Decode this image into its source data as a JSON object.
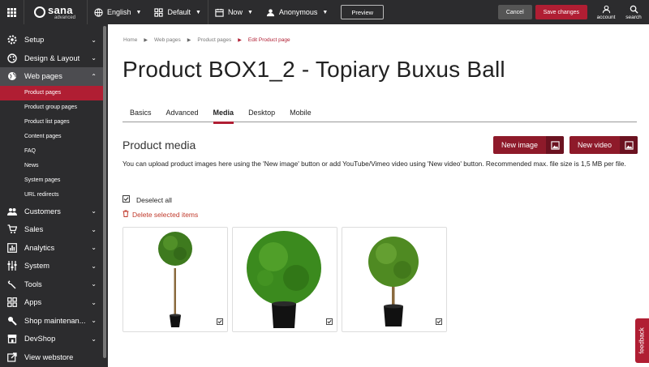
{
  "topbar": {
    "logo_name": "sana",
    "logo_sub": "advanced",
    "language": "English",
    "layout": "Default",
    "date": "Now",
    "user": "Anonymous",
    "preview_label": "Preview",
    "cancel_label": "Cancel",
    "save_label": "Save changes",
    "account_label": "account",
    "search_label": "search"
  },
  "sidebar": {
    "items": [
      {
        "label": "Setup",
        "icon": "gear-icon"
      },
      {
        "label": "Design & Layout",
        "icon": "palette-icon"
      },
      {
        "label": "Web pages",
        "icon": "globe-icon",
        "active": true
      },
      {
        "label": "Customers",
        "icon": "people-icon"
      },
      {
        "label": "Sales",
        "icon": "cart-icon"
      },
      {
        "label": "Analytics",
        "icon": "chart-icon"
      },
      {
        "label": "System",
        "icon": "sliders-icon"
      },
      {
        "label": "Tools",
        "icon": "wrench-icon"
      },
      {
        "label": "Apps",
        "icon": "apps-icon"
      },
      {
        "label": "Shop maintenan...",
        "icon": "maintenance-icon"
      },
      {
        "label": "DevShop",
        "icon": "shop-icon"
      },
      {
        "label": "View webstore",
        "icon": "external-link-icon"
      }
    ],
    "subitems": [
      "Product pages",
      "Product group pages",
      "Product list pages",
      "Content pages",
      "FAQ",
      "News",
      "System pages",
      "URL redirects"
    ]
  },
  "breadcrumb": [
    "Home",
    "Web pages",
    "Product pages",
    "Edit Product page"
  ],
  "page_title": "Product BOX1_2 - Topiary Buxus Ball",
  "tabs": [
    "Basics",
    "Advanced",
    "Media",
    "Desktop",
    "Mobile"
  ],
  "media": {
    "section_title": "Product media",
    "new_image_label": "New image",
    "new_video_label": "New video",
    "description": "You can upload product images here using the 'New image' button or add YouTube/Vimeo video using 'New video' button. Recommended max. file size is 1,5 MB per file.",
    "deselect_all_label": "Deselect all",
    "delete_selected_label": "Delete selected items"
  },
  "feedback_label": "feedback",
  "colors": {
    "accent": "#b01e33",
    "dark_bg": "#2c2c2e",
    "button_dark_red": "#8e1a2a"
  }
}
